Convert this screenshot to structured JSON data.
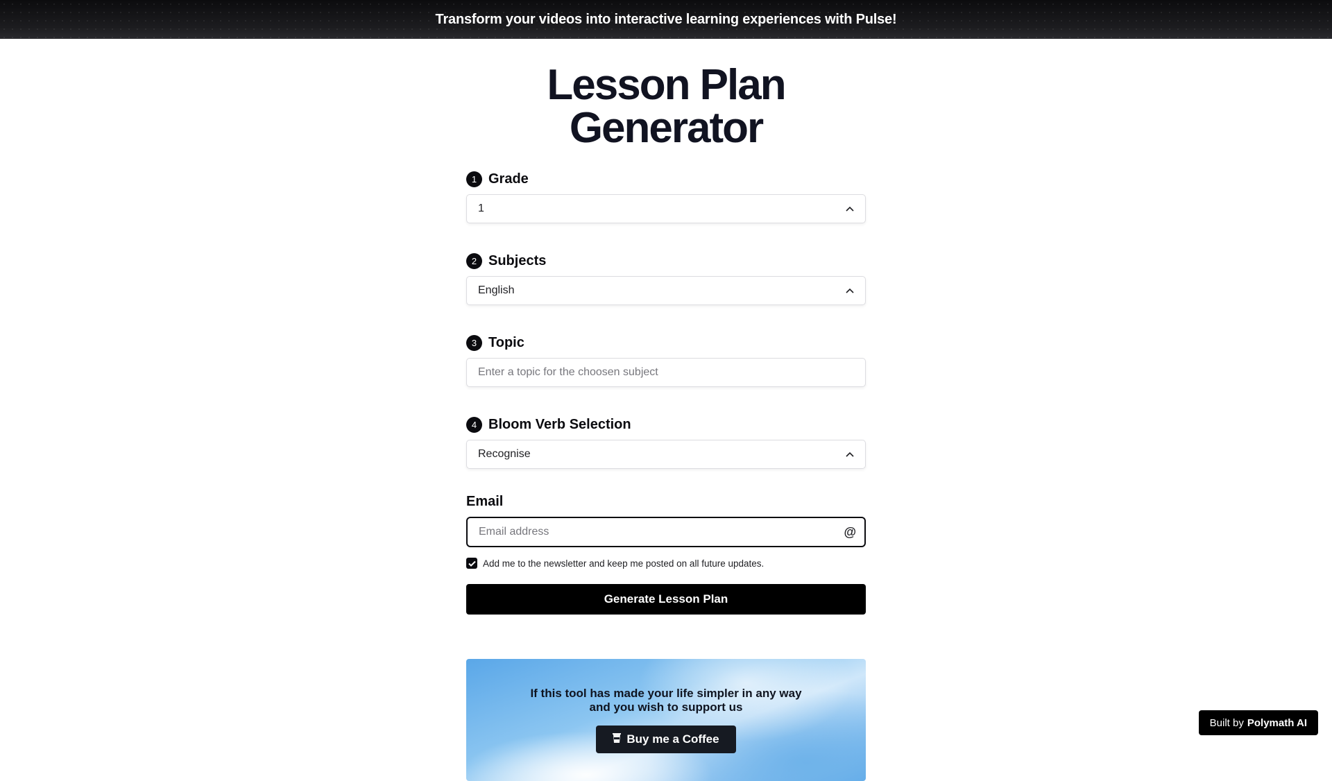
{
  "banner": {
    "text": "Transform your videos into interactive learning experiences with Pulse!"
  },
  "page": {
    "title": "Lesson Plan Generator"
  },
  "form": {
    "grade": {
      "step": "1",
      "label": "Grade",
      "value": "1",
      "icon": "chevron-up-icon"
    },
    "subjects": {
      "step": "2",
      "label": "Subjects",
      "value": "English",
      "icon": "chevron-up-icon"
    },
    "topic": {
      "step": "3",
      "label": "Topic",
      "placeholder": "Enter a topic for the choosen subject",
      "value": ""
    },
    "bloom": {
      "step": "4",
      "label": "Bloom Verb Selection",
      "value": "Recognise",
      "icon": "chevron-up-icon"
    },
    "email": {
      "label": "Email",
      "placeholder": "Email address",
      "value": "",
      "icon": "at-sign-icon"
    },
    "newsletter": {
      "checked": true,
      "label": "Add me to the newsletter and keep me posted on all future updates."
    },
    "submit_label": "Generate Lesson Plan"
  },
  "support": {
    "line1": "If this tool has made your life simpler in any way",
    "line2": "and you wish to support us",
    "button_label": "Buy me a Coffee",
    "button_icon": "coffee-cup-icon"
  },
  "footer": {
    "built_by_prefix": "Built by",
    "built_by_name": "Polymath AI"
  },
  "colors": {
    "primary": "#000000",
    "title": "#111321",
    "card_blue": "#5aa7e8"
  }
}
